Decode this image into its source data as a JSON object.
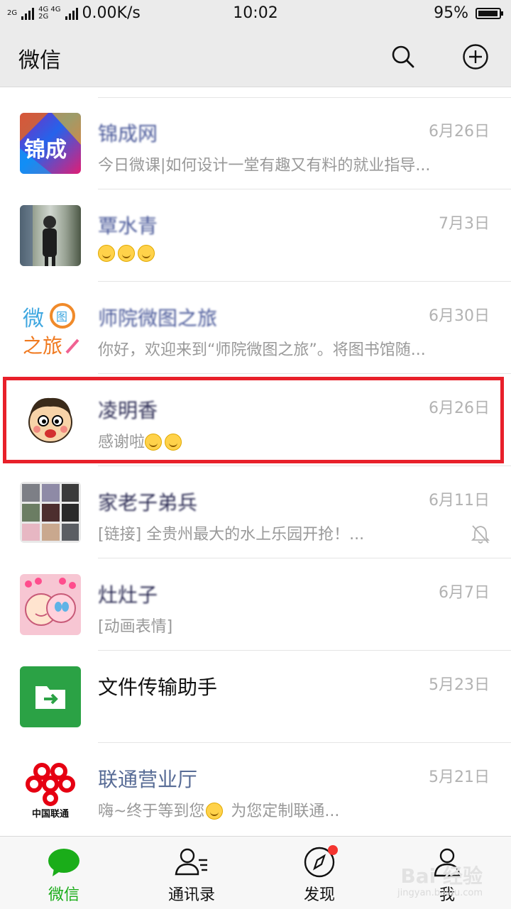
{
  "status": {
    "net_speed": "0.00K/s",
    "time": "10:02",
    "battery": "95%",
    "battery_level": 0.95
  },
  "header": {
    "title": "微信"
  },
  "chats": [
    {
      "name": "锦成网",
      "date": "6月26日",
      "preview": "今日微课|如何设计一堂有趣又有料的就业指导..."
    },
    {
      "name": "覃水青",
      "date": "7月3日",
      "preview": ""
    },
    {
      "name": "师院微图之旅",
      "date": "6月30日",
      "preview": "你好，欢迎来到“师院微图之旅”。将图书馆随..."
    },
    {
      "name": "凌明香",
      "date": "6月26日",
      "preview": "感谢啦"
    },
    {
      "name": "家老子弟兵",
      "date": "6月11日",
      "preview": "[链接] 全贵州最大的水上乐园开抢！..."
    },
    {
      "name": "灶灶子",
      "date": "6月7日",
      "preview": "[动画表情]"
    },
    {
      "name": "文件传输助手",
      "date": "5月23日",
      "preview": ""
    },
    {
      "name": "联通营业厅",
      "date": "5月21日",
      "preview": "嗨~终于等到您",
      "preview2": " 为您定制联通..."
    }
  ],
  "avatars": {
    "jc_text": "锦成",
    "wei": "微",
    "zhilv": "之旅",
    "tu": "图",
    "unicom": "中国联通"
  },
  "tabs": [
    {
      "label": "微信"
    },
    {
      "label": "通讯录"
    },
    {
      "label": "发现"
    },
    {
      "label": "我"
    }
  ],
  "watermark": {
    "main": "Bai 经验",
    "sub": "jingyan.baidu.com"
  },
  "colors": {
    "accent": "#1aad19",
    "link": "#576b95",
    "highlight": "#e8202a",
    "badge": "#f43530"
  }
}
